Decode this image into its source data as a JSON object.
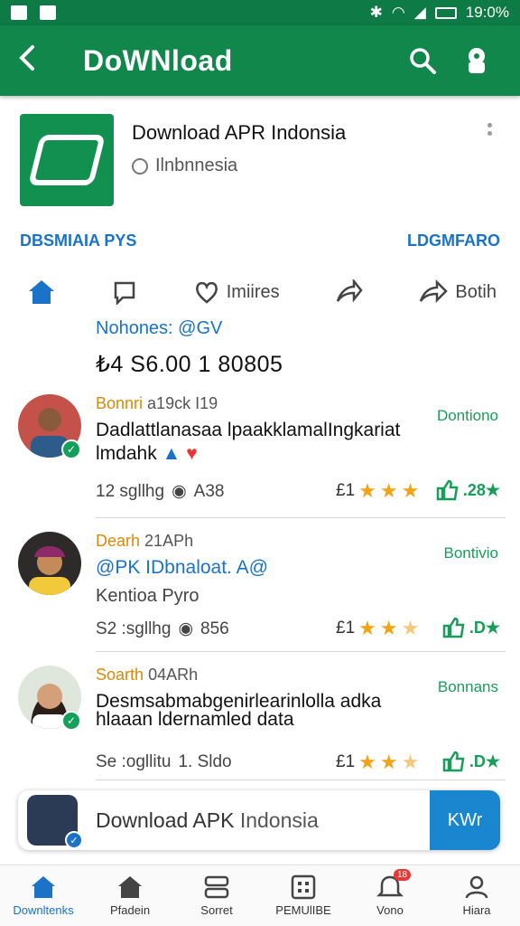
{
  "status_bar": {
    "time": "19:0%"
  },
  "app_bar": {
    "title": "DoWNload"
  },
  "app": {
    "name": "Download APR Indonsia",
    "region": "Ilnbnnesia"
  },
  "links": {
    "left": "DBSMIAIA PYS",
    "right": "LDGMFARO"
  },
  "actions": {
    "like_label": "Imiires",
    "share_label": "Botih"
  },
  "section": {
    "label": "Nohones: @GV",
    "price": "₺4 S6.00 1 80805"
  },
  "reviews": [
    {
      "author": "Bonnri",
      "date": "a19ck I19",
      "status": "Dontiono",
      "text": "Dadlattlanasaa lpaakklamalIngkariat",
      "text2": "lmdahk",
      "meta_left": "12 sgllhg",
      "meta_right": "A38",
      "rating_prefix": "£1",
      "rating": 3,
      "likes": ".28★"
    },
    {
      "author": "Dearh",
      "date": "21APh",
      "status": "Bontivio",
      "text": "@PK IDbnaloat. A@",
      "text2": "Kentioa Pyro",
      "meta_left": "S2 :sgllhg",
      "meta_right": "856",
      "rating_prefix": "£1",
      "rating": 2.5,
      "likes": ".D★"
    },
    {
      "author": "Soarth",
      "date": "04ARh",
      "status": "Bonnans",
      "text": "Desmsabmabgenirlearinlolla adka",
      "text2": "hlaaan ldernamled data",
      "meta_left": "Se :ogllitu",
      "meta_right": "1. Sldo",
      "rating_prefix": "£1",
      "rating": 2.5,
      "likes": ".D★"
    }
  ],
  "banner": {
    "title_bold": "Download APK",
    "title_light": "Indonsia",
    "button": "KWr"
  },
  "bottom_nav": [
    {
      "label": "Downltenks",
      "icon": "home-icon",
      "active": true
    },
    {
      "label": "Pfadein",
      "icon": "house-icon",
      "active": false
    },
    {
      "label": "Sorret",
      "icon": "layers-icon",
      "active": false
    },
    {
      "label": "PEMUlIBE",
      "icon": "grid-icon",
      "active": false
    },
    {
      "label": "Vono",
      "icon": "bell-icon",
      "active": false,
      "badge": "18"
    },
    {
      "label": "Hiara",
      "icon": "profile-icon",
      "active": false
    }
  ],
  "colors": {
    "brand": "#11874c",
    "accent": "#1a73c8",
    "star": "#f2a414"
  }
}
